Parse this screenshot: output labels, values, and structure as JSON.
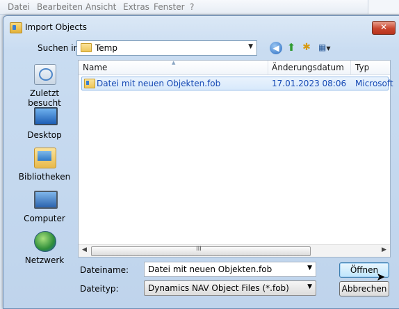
{
  "app_menu": [
    "Datei",
    "Bearbeiten",
    "Ansicht",
    "Extras",
    "Fenster",
    "?"
  ],
  "dialog": {
    "title": "Import Objects",
    "close_label": "✕"
  },
  "lookin": {
    "label": "Suchen in:",
    "value": "Temp"
  },
  "places": [
    {
      "label": "Zuletzt besucht",
      "icon": "recent-places-icon"
    },
    {
      "label": "Desktop",
      "icon": "desktop-icon"
    },
    {
      "label": "Bibliotheken",
      "icon": "libraries-icon"
    },
    {
      "label": "Computer",
      "icon": "computer-icon"
    },
    {
      "label": "Netzwerk",
      "icon": "network-icon"
    }
  ],
  "filelist": {
    "columns": [
      "Name",
      "Änderungsdatum",
      "Typ"
    ],
    "rows": [
      {
        "name": "Datei mit neuen Objekten.fob",
        "date": "17.01.2023 08:06",
        "type": "Microsoft"
      }
    ],
    "scroll_grip": "III"
  },
  "filename": {
    "label": "Dateiname:",
    "value": "Datei mit neuen Objekten.fob"
  },
  "filetype": {
    "label": "Dateityp:",
    "value": "Dynamics NAV Object Files (*.fob)"
  },
  "buttons": {
    "open": "Öffnen",
    "cancel": "Abbrechen"
  },
  "colors": {
    "selection_text": "#1448b4",
    "close_button": "#c9462f"
  }
}
